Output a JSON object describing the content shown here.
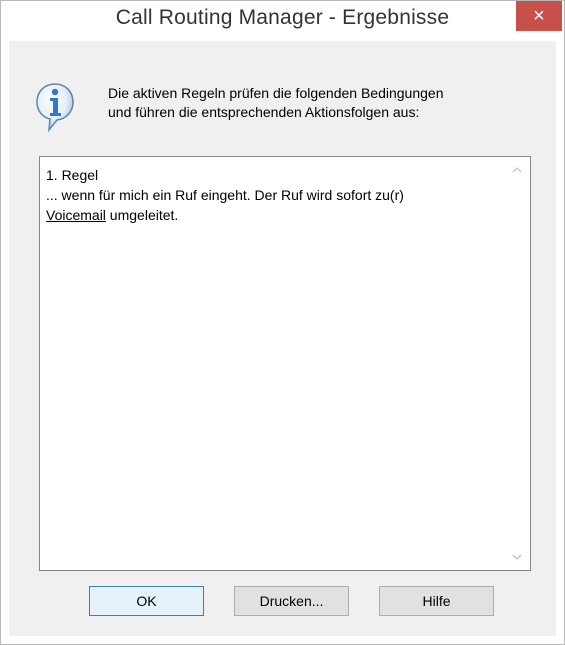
{
  "window": {
    "title": "Call Routing Manager - Ergebnisse",
    "close_glyph": "×"
  },
  "message": {
    "icon": "info-icon",
    "line1": "Die aktiven Regeln prüfen die folgenden Bedingungen",
    "line2": "und führen die entsprechenden Aktionsfolgen aus:"
  },
  "results": {
    "rule_title": "1. Regel",
    "line2": "... wenn für mich ein Ruf eingeht. Der Ruf wird sofort zu(r)",
    "link_text": "Voicemail",
    "line3_suffix": " umgeleitet."
  },
  "buttons": {
    "ok": "OK",
    "print": "Drucken...",
    "help": "Hilfe"
  },
  "colors": {
    "close_button": "#c7504b",
    "info_icon": "#2e7ac8",
    "dialog_background": "#f0f0f0",
    "default_button_border": "#3c7fb1"
  }
}
